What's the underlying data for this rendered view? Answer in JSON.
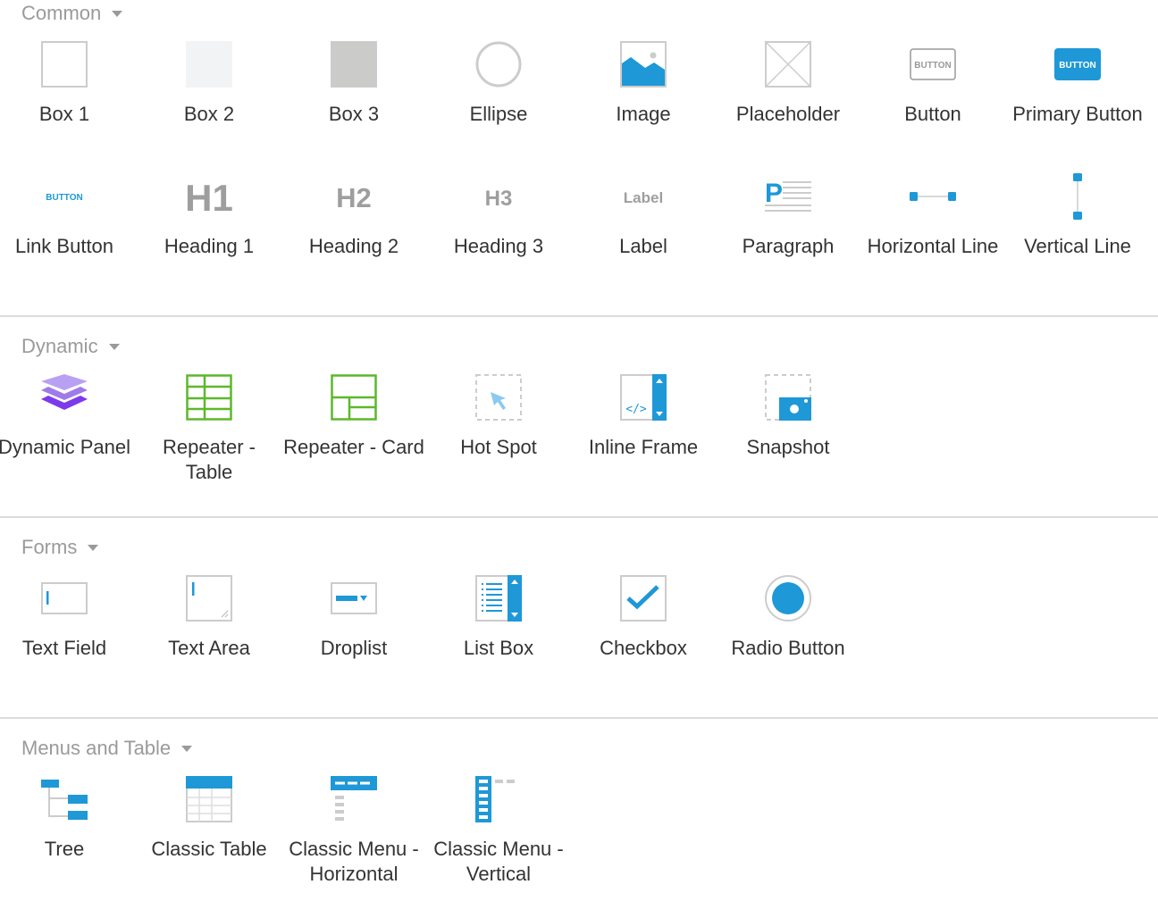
{
  "accent": "#1e98d7",
  "sections": [
    {
      "title": "Common",
      "items": [
        {
          "label": "Box 1",
          "icon": "box1-icon"
        },
        {
          "label": "Box 2",
          "icon": "box2-icon"
        },
        {
          "label": "Box 3",
          "icon": "box3-icon"
        },
        {
          "label": "Ellipse",
          "icon": "ellipse-icon"
        },
        {
          "label": "Image",
          "icon": "image-icon"
        },
        {
          "label": "Placeholder",
          "icon": "placeholder-icon"
        },
        {
          "label": "Button",
          "icon": "button-icon",
          "icon_text": "BUTTON"
        },
        {
          "label": "Primary Button",
          "icon": "primary-button-icon",
          "icon_text": "BUTTON"
        },
        {
          "label": "Link Button",
          "icon": "link-button-icon",
          "icon_text": "BUTTON"
        },
        {
          "label": "Heading 1",
          "icon": "heading1-icon",
          "icon_text": "H1"
        },
        {
          "label": "Heading 2",
          "icon": "heading2-icon",
          "icon_text": "H2"
        },
        {
          "label": "Heading 3",
          "icon": "heading3-icon",
          "icon_text": "H3"
        },
        {
          "label": "Label",
          "icon": "label-icon",
          "icon_text": "Label"
        },
        {
          "label": "Paragraph",
          "icon": "paragraph-icon",
          "icon_text": "P"
        },
        {
          "label": "Horizontal Line",
          "icon": "horizontal-line-icon"
        },
        {
          "label": "Vertical Line",
          "icon": "vertical-line-icon"
        }
      ]
    },
    {
      "title": "Dynamic",
      "items": [
        {
          "label": "Dynamic Panel",
          "icon": "layers-icon"
        },
        {
          "label": "Repeater - Table",
          "icon": "repeater-table-icon"
        },
        {
          "label": "Repeater - Card",
          "icon": "repeater-card-icon"
        },
        {
          "label": "Hot Spot",
          "icon": "hotspot-icon"
        },
        {
          "label": "Inline Frame",
          "icon": "inline-frame-icon",
          "icon_text": "</>"
        },
        {
          "label": "Snapshot",
          "icon": "snapshot-icon"
        }
      ]
    },
    {
      "title": "Forms",
      "items": [
        {
          "label": "Text Field",
          "icon": "text-field-icon"
        },
        {
          "label": "Text Area",
          "icon": "text-area-icon"
        },
        {
          "label": "Droplist",
          "icon": "droplist-icon"
        },
        {
          "label": "List Box",
          "icon": "list-box-icon"
        },
        {
          "label": "Checkbox",
          "icon": "checkbox-icon"
        },
        {
          "label": "Radio Button",
          "icon": "radio-button-icon"
        }
      ]
    },
    {
      "title": "Menus and Table",
      "items": [
        {
          "label": "Tree",
          "icon": "tree-icon"
        },
        {
          "label": "Classic Table",
          "icon": "classic-table-icon"
        },
        {
          "label": "Classic Menu - Horizontal",
          "icon": "menu-horizontal-icon"
        },
        {
          "label": "Classic Menu - Vertical",
          "icon": "menu-vertical-icon"
        }
      ]
    }
  ]
}
